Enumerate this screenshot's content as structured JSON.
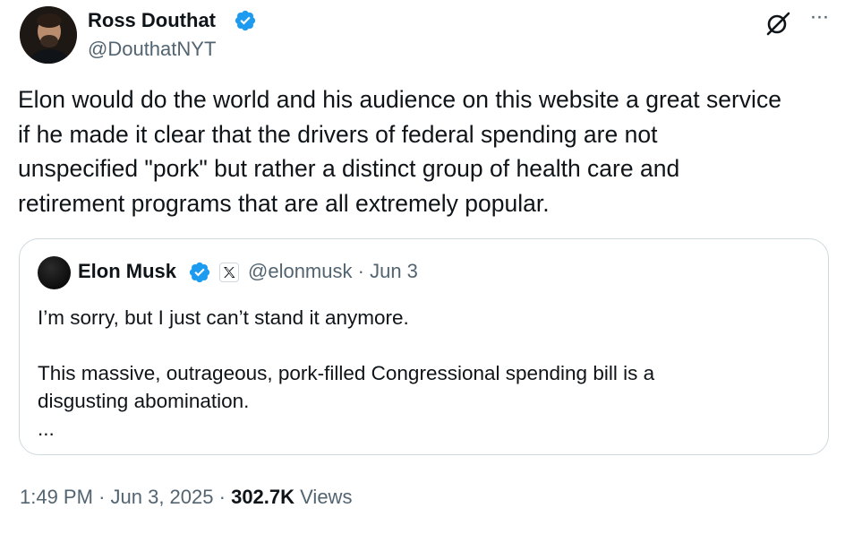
{
  "tweet": {
    "author": {
      "name": "Ross Douthat",
      "handle": "@DouthatNYT",
      "verified": true
    },
    "text": "Elon would do the world and his audience on this website a great service\nif he made it clear that the drivers of federal spending are not\nunspecified \"pork\" but rather a distinct group of health care and\nretirement programs that are all extremely popular.",
    "actions": {
      "grok_icon": "grok-icon",
      "more_icon": "more-icon",
      "more_label": "···"
    },
    "quoted": {
      "author_name": "Elon Musk",
      "handle": "@elonmusk",
      "separator": "·",
      "date": "Jun 3",
      "verified": true,
      "affiliate_badge": "x-logo-icon",
      "text": "I’m sorry, but I just can’t stand it anymore.\n\nThis massive, outrageous, pork-filled Congressional spending bill is a\ndisgusting abomination.\n..."
    },
    "footer": {
      "time": "1:49 PM",
      "separator": "·",
      "date": "Jun 3, 2025",
      "views_count": "302.7K",
      "views_label": "Views"
    }
  },
  "colors": {
    "text": "#0f1419",
    "secondary": "#536471",
    "verified": "#1d9bf0",
    "border": "#cfd9de"
  }
}
